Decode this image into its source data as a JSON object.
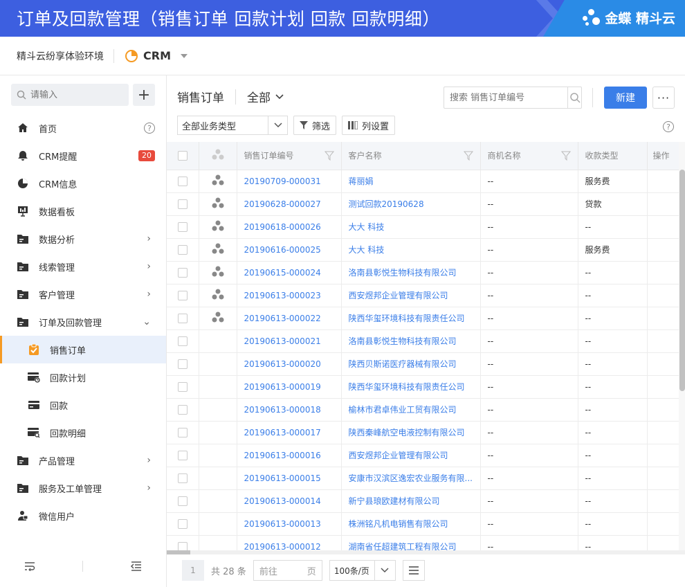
{
  "banner": {
    "title": "订单及回款管理（销售订单  回款计划  回款  回款明细）",
    "brand": "金蝶 精斗云"
  },
  "topbar": {
    "environment": "精斗云纷享体验环境",
    "app_name": "CRM"
  },
  "sidebar": {
    "search_placeholder": "请输入",
    "add_label": "+",
    "items": [
      {
        "label": "首页",
        "icon": "home-icon",
        "help": "?"
      },
      {
        "label": "CRM提醒",
        "icon": "bell-icon",
        "badge": "20"
      },
      {
        "label": "CRM信息",
        "icon": "pie-icon"
      },
      {
        "label": "数据看板",
        "icon": "board-icon"
      },
      {
        "label": "数据分析",
        "icon": "folder-icon",
        "arrow": "›"
      },
      {
        "label": "线索管理",
        "icon": "folder-icon",
        "arrow": "›"
      },
      {
        "label": "客户管理",
        "icon": "folder-icon",
        "arrow": "›"
      },
      {
        "label": "订单及回款管理",
        "icon": "folder-icon",
        "arrow": "⌄"
      },
      {
        "label": "销售订单",
        "icon": "clipboard-check-icon",
        "sub": true,
        "active": true
      },
      {
        "label": "回款计划",
        "icon": "card-plan-icon",
        "sub": true
      },
      {
        "label": "回款",
        "icon": "card-icon",
        "sub": true
      },
      {
        "label": "回款明细",
        "icon": "card-detail-icon",
        "sub": true
      },
      {
        "label": "产品管理",
        "icon": "folder-icon",
        "arrow": "›"
      },
      {
        "label": "服务及工单管理",
        "icon": "folder-icon",
        "arrow": "›"
      },
      {
        "label": "微信用户",
        "icon": "wechat-user-icon"
      }
    ]
  },
  "main": {
    "title": "销售订单",
    "scope": "全部",
    "search_placeholder": "搜索 销售订单编号",
    "new_label": "新建",
    "more_label": "···",
    "business_type": "全部业务类型",
    "filter_label": "筛选",
    "columns_label": "列设置",
    "help": "?"
  },
  "table": {
    "headers": [
      "销售订单编号",
      "客户名称",
      "商机名称",
      "收款类型",
      "操作"
    ],
    "rows": [
      {
        "id": "20190709-000031",
        "customer": "蒋丽娟",
        "opportunity": "--",
        "type": "服务费",
        "group": true
      },
      {
        "id": "20190628-000027",
        "customer": "测试回款20190628",
        "opportunity": "--",
        "type": "贷款",
        "group": true
      },
      {
        "id": "20190618-000026",
        "customer": "大大 科技",
        "opportunity": "--",
        "type": "--",
        "group": true
      },
      {
        "id": "20190616-000025",
        "customer": "大大 科技",
        "opportunity": "--",
        "type": "服务费",
        "group": true
      },
      {
        "id": "20190615-000024",
        "customer": "洛南县彰悦生物科技有限公司",
        "opportunity": "--",
        "type": "--",
        "group": true
      },
      {
        "id": "20190613-000023",
        "customer": "西安煜邦企业管理有限公司",
        "opportunity": "--",
        "type": "--",
        "group": true
      },
      {
        "id": "20190613-000022",
        "customer": "陕西华玺环境科技有限责任公司",
        "opportunity": "--",
        "type": "--",
        "group": true
      },
      {
        "id": "20190613-000021",
        "customer": "洛南县彰悦生物科技有限公司",
        "opportunity": "--",
        "type": "--",
        "group": false
      },
      {
        "id": "20190613-000020",
        "customer": "陕西贝斯诺医疗器械有限公司",
        "opportunity": "--",
        "type": "--",
        "group": false
      },
      {
        "id": "20190613-000019",
        "customer": "陕西华玺环境科技有限责任公司",
        "opportunity": "--",
        "type": "--",
        "group": false
      },
      {
        "id": "20190613-000018",
        "customer": "榆林市君卓伟业工贸有限公司",
        "opportunity": "--",
        "type": "--",
        "group": false
      },
      {
        "id": "20190613-000017",
        "customer": "陕西秦峰航空电液控制有限公司",
        "opportunity": "--",
        "type": "--",
        "group": false
      },
      {
        "id": "20190613-000016",
        "customer": "西安煜邦企业管理有限公司",
        "opportunity": "--",
        "type": "--",
        "group": false
      },
      {
        "id": "20190613-000015",
        "customer": "安康市汉滨区逸宏农业服务有限...",
        "opportunity": "--",
        "type": "--",
        "group": false
      },
      {
        "id": "20190613-000014",
        "customer": "新宁县琅欧建材有限公司",
        "opportunity": "--",
        "type": "--",
        "group": false
      },
      {
        "id": "20190613-000013",
        "customer": "株洲铭凡机电销售有限公司",
        "opportunity": "--",
        "type": "--",
        "group": false
      },
      {
        "id": "20190613-000012",
        "customer": "湖南省任超建筑工程有限公司",
        "opportunity": "--",
        "type": "--",
        "group": false
      }
    ]
  },
  "pager": {
    "current_page": "1",
    "total": "共 28 条",
    "goto_prefix": "前往",
    "goto_suffix": "页",
    "page_size": "100条/页"
  },
  "colors": {
    "banner": "#3d5fe0",
    "accent": "#3a7ee8",
    "active_marker": "#f59a23",
    "badge": "#e84a3c"
  }
}
